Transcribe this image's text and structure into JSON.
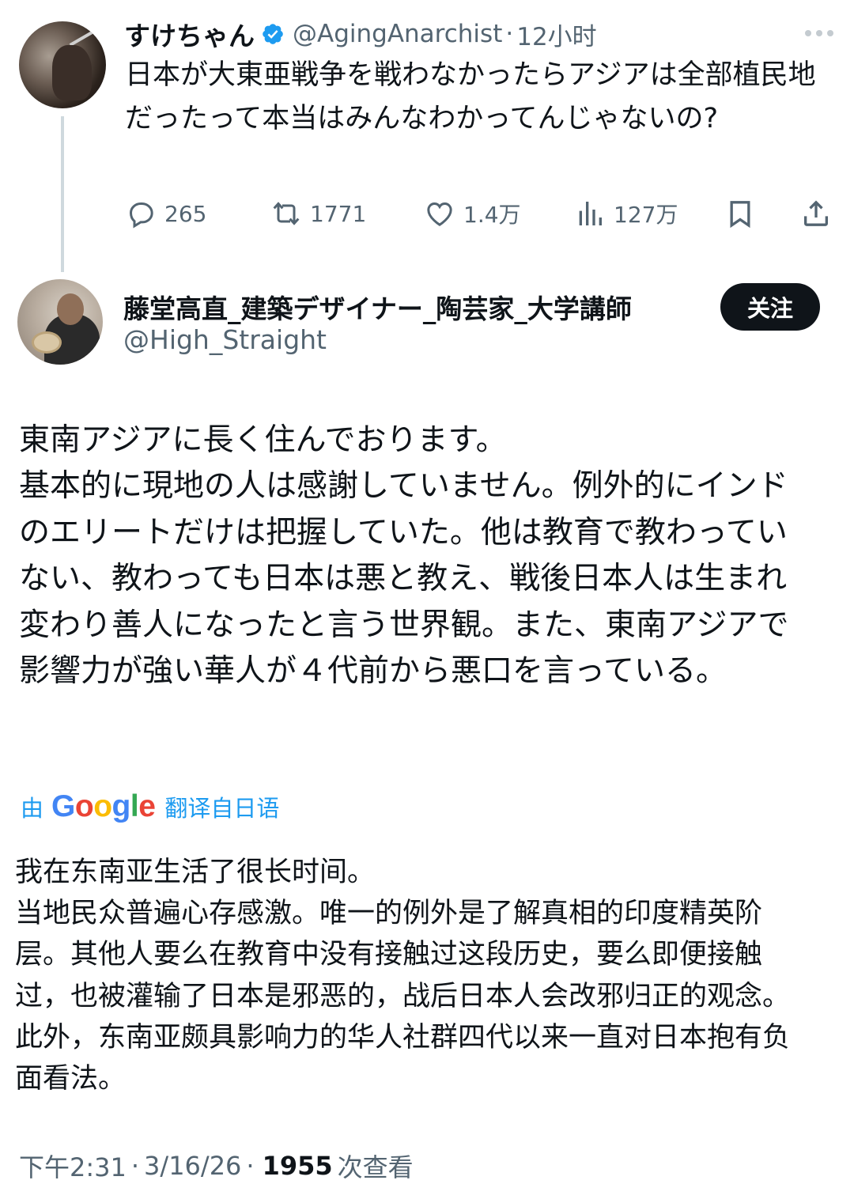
{
  "parent_tweet": {
    "display_name": "すけちゃん",
    "handle": "@AgingAnarchist",
    "separator": "·",
    "time": "12小时",
    "text": "日本が大東亜戦争を戦わなかったらアジアは全部植民地だったって本当はみんなわかってんじゃないの?",
    "stats": {
      "replies": "265",
      "retweets": "1771",
      "likes": "1.4万",
      "views": "127万"
    },
    "icons": [
      "verified-badge-icon",
      "more-icon",
      "reply-icon",
      "retweet-icon",
      "like-icon",
      "views-icon",
      "bookmark-icon",
      "share-icon"
    ]
  },
  "reply_tweet": {
    "display_name": "藤堂高直_建築デザイナー_陶芸家_大学講師",
    "handle": "@High_Straight",
    "follow_label": "关注",
    "text": "東南アジアに長く住んでおります。\n基本的に現地の人は感謝していません。例外的にインドのエリートだけは把握していた。他は教育で教わっていない、教わっても日本は悪と教え、戦後日本人は生まれ変わり善人になったと言う世界観。また、東南アジアで影響力が強い華人が４代前から悪口を言っている。",
    "translation": {
      "by": "由",
      "provider": "Google",
      "label": "翻译自日语"
    },
    "translated_text": "我在东南亚生活了很长时间。\n当地民众普遍心存感激。唯一的例外是了解真相的印度精英阶层。其他人要么在教育中没有接触过这段历史，要么即便接触过，也被灌输了日本是邪恶的，战后日本人会改邪归正的观念。此外，东南亚颇具影响力的华人社群四代以来一直对日本抱有负面看法。",
    "time": "下午2:31",
    "date": "3/16/26",
    "views_count": "1955",
    "views_label": "次查看"
  },
  "colors": {
    "text_primary": "#0f1419",
    "text_secondary": "#536471",
    "accent_blue": "#1d9bf0",
    "thread_line": "#cfd9de",
    "follow_button_bg": "#0f1419"
  }
}
